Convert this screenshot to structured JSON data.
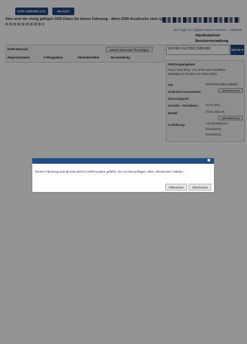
{
  "nav": {
    "dsr_button": "DSR-ÜBERBLICK",
    "report_button": "Bericht"
  },
  "warning": "Dies sind die einzig gültigen DSR-Daten für dieses Fahrzeug - ältere DSR-Ausdrucke stets ignorie",
  "help_link": "Bei Fragen zu: Digitales Service Rechnen – Startseite",
  "dealer": {
    "line1": "Händlerbetrieb-",
    "line2": "Benutzerverwaltung"
  },
  "dsr_history": {
    "title": "DSR-Historie",
    "new_record_button": "Neuen Datensatz hinzufügen",
    "columns": [
      "Reparaturdatum",
      "Auftragsdaten",
      "Kilometerzähler",
      "Beschreibung"
    ]
  },
  "vin_search": {
    "value": "WF0KXXGCBKCS85083",
    "more_button": "WEITE R"
  },
  "vehicle": {
    "title": "Fahrzeugangaben",
    "model_line1": "Focus 2011-2015, 1.0L GTDI 125 TC130PS1,",
    "model_line2": "MOONDUST SILVER C/C NSE GOLD",
    "vin_label": "VIN:",
    "vin_value": "WF0KXXGCBKCS85083",
    "official_label": "Amtliches Kennzeichen:",
    "update_button_1": "Aktualisierung",
    "registration_label": "Zulassungsmd.",
    "warranty_label": "Garantie - Startdatum:",
    "warranty_value": "19.12.2012",
    "model_label": "Modell:",
    "model_value": "Focus 2011.25",
    "update_button_2": "Aktualisierung",
    "version_label": "Ausführung:",
    "version_line1": "1.0L ECOBOOST",
    "version_line2": "(01/10/2011 -",
    "version_line3": "01/08/2015)"
  },
  "dialog": {
    "close_symbol": "✖",
    "message": "Dieses Fahrzeug wird derzeit nicht im DSR-System geführt. Um es hinzuzufügen, bitte „Abschicken“ wählen.",
    "cancel_button": "Abbrechen",
    "submit_button": "Abschicken"
  },
  "colors": {
    "brand_blue": "#1f4b86",
    "overlay": "rgba(0,0,0,0.42)"
  }
}
